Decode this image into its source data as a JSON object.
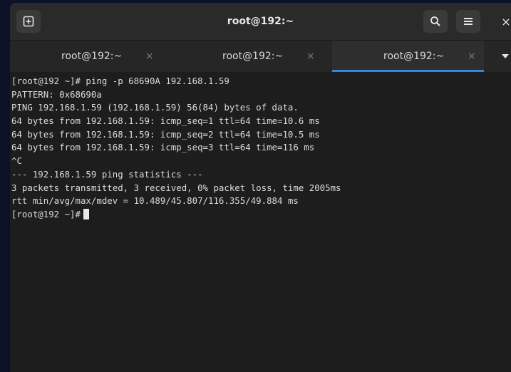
{
  "window": {
    "title": "root@192:~"
  },
  "header": {
    "new_tab_icon": "new-tab-icon",
    "search_icon": "search-icon",
    "menu_icon": "hamburger-menu-icon",
    "close_glyph": "×"
  },
  "tabs": [
    {
      "label": "root@192:~",
      "close": "×",
      "active": false
    },
    {
      "label": "root@192:~",
      "close": "×",
      "active": false
    },
    {
      "label": "root@192:~",
      "close": "×",
      "active": true
    }
  ],
  "terminal": {
    "lines": [
      "[root@192 ~]# ping -p 68690A 192.168.1.59",
      "PATTERN: 0x68690a",
      "PING 192.168.1.59 (192.168.1.59) 56(84) bytes of data.",
      "64 bytes from 192.168.1.59: icmp_seq=1 ttl=64 time=10.6 ms",
      "64 bytes from 192.168.1.59: icmp_seq=2 ttl=64 time=10.5 ms",
      "64 bytes from 192.168.1.59: icmp_seq=3 ttl=64 time=116 ms",
      "^C",
      "--- 192.168.1.59 ping statistics ---",
      "3 packets transmitted, 3 received, 0% packet loss, time 2005ms",
      "rtt min/avg/max/mdev = 10.489/45.807/116.355/49.884 ms"
    ],
    "prompt": "[root@192 ~]#"
  },
  "colors": {
    "accent": "#3584e4",
    "terminal_bg": "#1d1d1d",
    "desktop_bg": "#0a1128"
  }
}
